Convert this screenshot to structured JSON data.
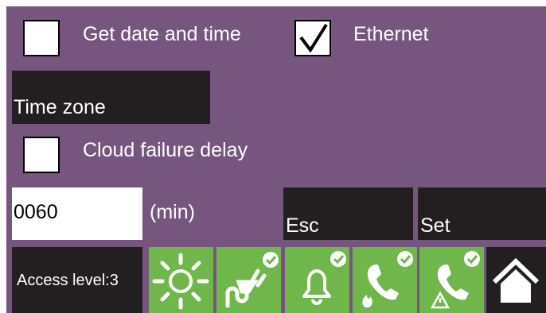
{
  "settings": {
    "get_date_time": {
      "label": "Get date and time",
      "checked": false
    },
    "ethernet": {
      "label": "Ethernet",
      "checked": true
    },
    "time_zone_label": "Time zone",
    "cloud_failure_delay": {
      "label": "Cloud failure delay",
      "checked": false
    },
    "delay_value": "0060",
    "delay_unit": "(min)",
    "esc_label": "Esc",
    "set_label": "Set"
  },
  "status_bar": {
    "access_level": "Access level:3",
    "icons": [
      "sun-icon",
      "mains-power-ok-icon",
      "alarm-bell-ok-icon",
      "fire-call-ok-icon",
      "warning-call-ok-icon",
      "home-icon"
    ]
  },
  "colors": {
    "background": "#76557f",
    "dark_button": "#231f20",
    "status_green": "#6fb64b",
    "text_light": "#ffffff"
  }
}
